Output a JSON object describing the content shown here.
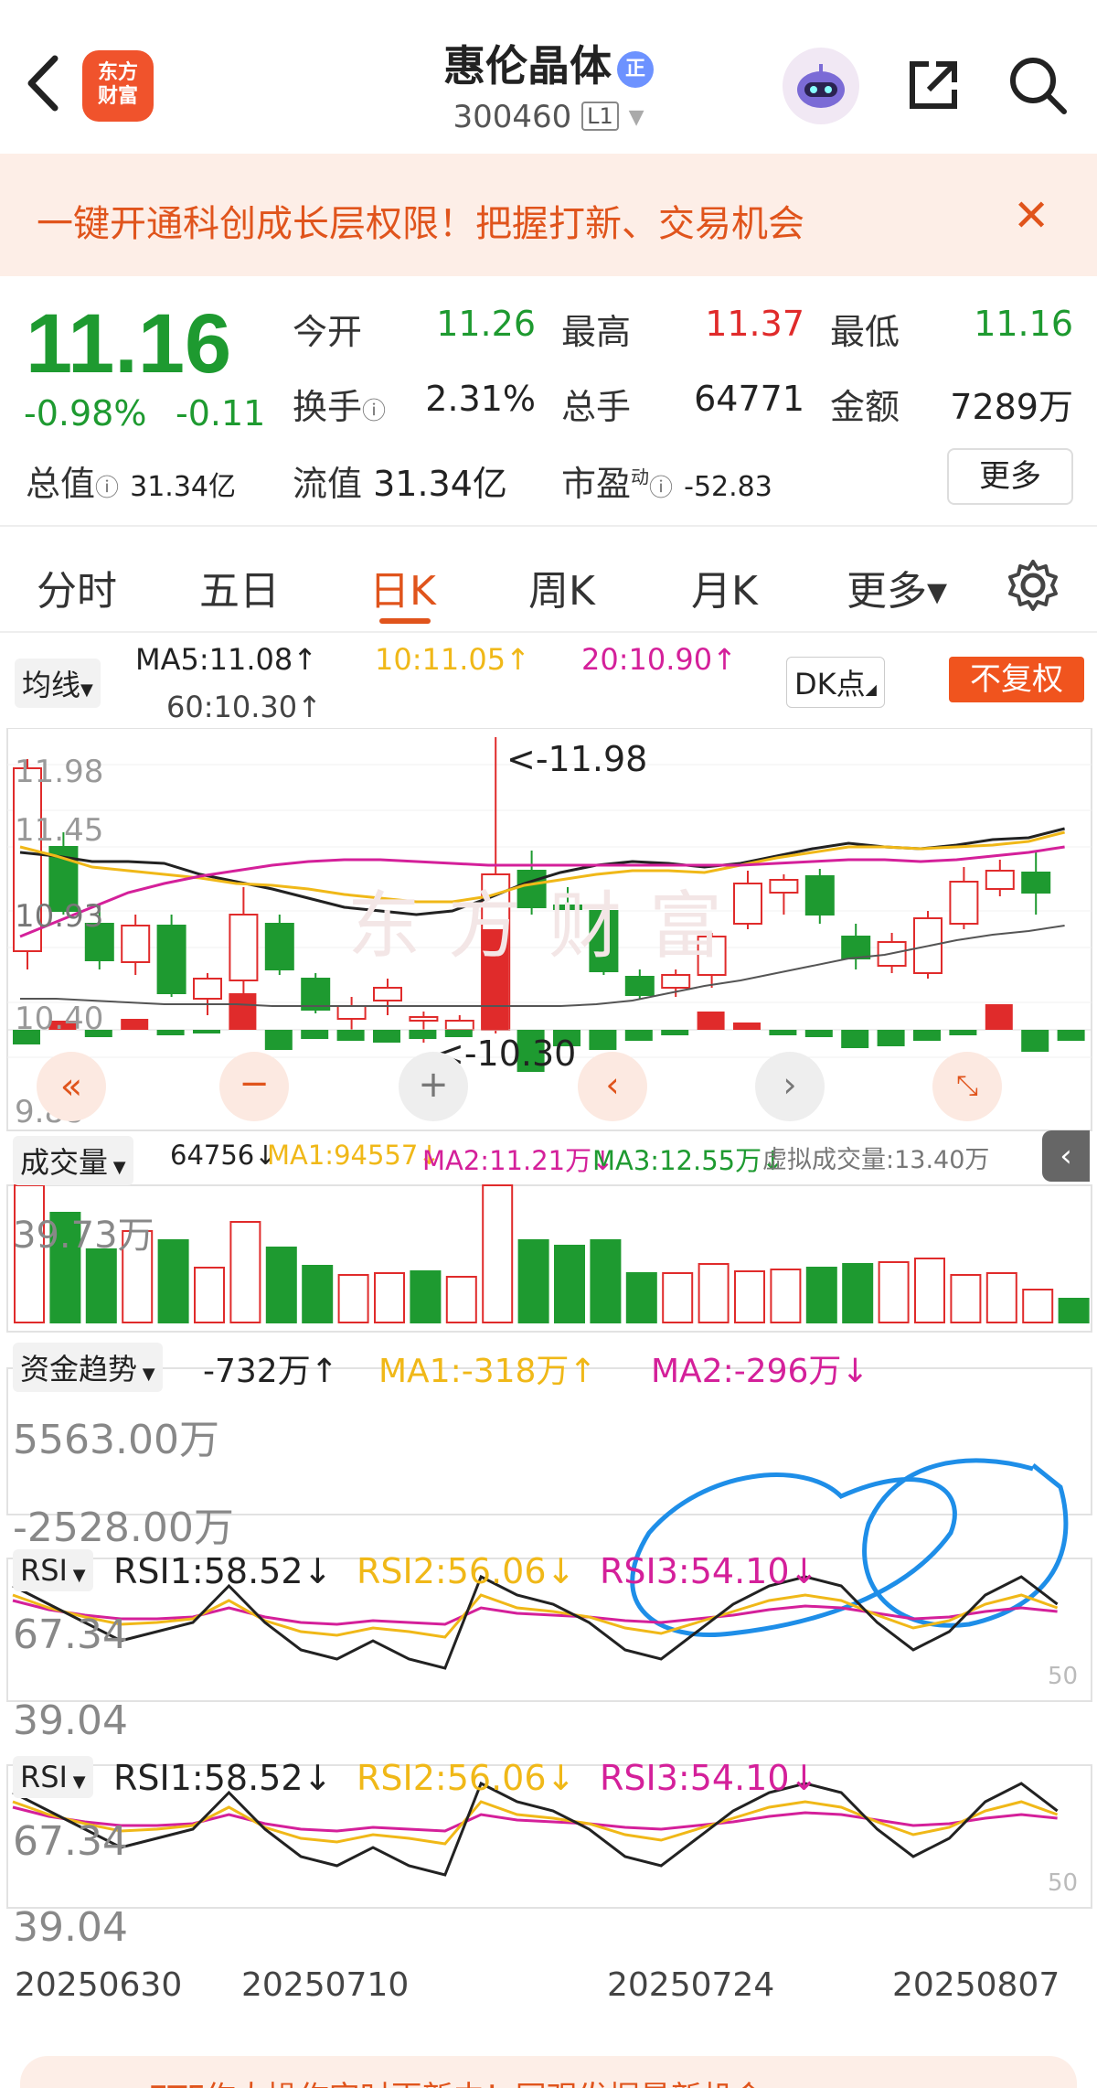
{
  "header": {
    "logo_text_1": "东方",
    "logo_text_2": "财富",
    "stock_name": "惠伦晶体",
    "name_badge": "正",
    "stock_code": "300460",
    "level": "L1"
  },
  "promo": {
    "text": "一键开通科创成长层权限！把握打新、交易机会",
    "close": "✕"
  },
  "quote": {
    "price": "11.16",
    "change_pct": "-0.98%",
    "change": "-0.11",
    "open_label": "今开",
    "open": "11.26",
    "high_label": "最高",
    "high": "11.37",
    "low_label": "最低",
    "low": "11.16",
    "turnover_label": "换手",
    "turnover": "2.31%",
    "volume_label": "总手",
    "volume": "64771",
    "amount_label": "金额",
    "amount": "7289万",
    "mktcap_label": "总值",
    "mktcap": "31.34亿",
    "float_label": "流值",
    "float": "31.34亿",
    "pe_label": "市盈",
    "pe_sup": "动",
    "pe": "-52.83",
    "more_label": "更多"
  },
  "tabs": [
    {
      "label": "分时"
    },
    {
      "label": "五日"
    },
    {
      "label": "日K"
    },
    {
      "label": "周K"
    },
    {
      "label": "月K"
    },
    {
      "label": "更多▾"
    }
  ],
  "ma": {
    "selector": "均线",
    "ma5": "MA5:11.08↑",
    "ma10": "10:11.05↑",
    "ma20": "20:10.90↑",
    "ma60": "60:10.30↑",
    "dk_label": "DK点",
    "adjust_label": "不复权"
  },
  "colors": {
    "up": "#e02b2b",
    "down": "#1e9a30",
    "ma5": "#222222",
    "ma10": "#f0b818",
    "ma20": "#d4209a",
    "accent": "#e0541c",
    "annotation": "#1e8ee8"
  },
  "kline": {
    "y_ticks": [
      "11.98",
      "11.45",
      "10.93",
      "10.40",
      "9.88"
    ],
    "high_marker": "<-11.98",
    "low_marker": "<-10.30",
    "watermark": "东方财富"
  },
  "volume": {
    "selector": "成交量",
    "current": "64756↓",
    "ma1": "MA1:94557↓",
    "ma2": "MA2:11.21万↓",
    "ma3": "MA3:12.55万↓",
    "virtual": "虚拟成交量:13.40万",
    "y_max": "39.73万"
  },
  "fund": {
    "selector": "资金趋势",
    "current": "-732万↑",
    "ma1": "MA1:-318万↑",
    "ma2": "MA2:-296万↓",
    "y_max": "5563.00万",
    "y_min": "-2528.00万"
  },
  "rsi_panels": [
    {
      "selector": "RSI",
      "rsi1": "RSI1:58.52↓",
      "rsi2": "RSI2:56.06↓",
      "rsi3": "RSI3:54.10↓",
      "y_max": "67.34",
      "y_min": "39.04",
      "mid": "50"
    },
    {
      "selector": "RSI",
      "rsi1": "RSI1:58.52↓",
      "rsi2": "RSI2:56.06↓",
      "rsi3": "RSI3:54.10↓",
      "y_max": "67.34",
      "y_min": "39.04",
      "mid": "50"
    }
  ],
  "dates": [
    "20250630",
    "20250710",
    "20250724",
    "20250807"
  ],
  "bottom_promo": "ETF作大操作实时更新中！同观发掘最新机会"
}
